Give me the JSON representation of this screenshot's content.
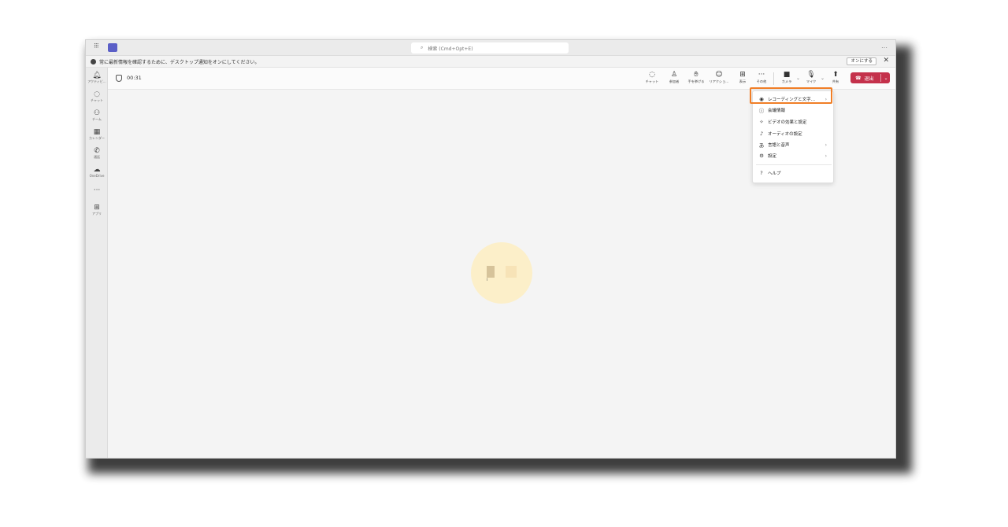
{
  "titlebar": {
    "search_placeholder": "検索 (Cmd+Opt+E)",
    "search_icon": "search-icon",
    "more": "…"
  },
  "notification": {
    "text": "常に最新情報を確認するために、デスクトップ通知をオンにしてください。",
    "button": "オンにする",
    "close": "✕"
  },
  "rail": {
    "items": [
      {
        "icon": "bell-icon",
        "label": "アクティビ…"
      },
      {
        "icon": "chat-icon",
        "label": "チャット"
      },
      {
        "icon": "teams-icon",
        "label": "チーム"
      },
      {
        "icon": "calendar-icon",
        "label": "カレンダー"
      },
      {
        "icon": "phone-icon",
        "label": "通話"
      },
      {
        "icon": "cloud-icon",
        "label": "OneDrive"
      },
      {
        "icon": "more-icon",
        "label": ""
      },
      {
        "icon": "add-app-icon",
        "label": "アプリ"
      }
    ]
  },
  "callbar": {
    "timer": "00:31",
    "buttons": {
      "chat": "チャット",
      "people": "参加者",
      "raise_hand": "手を挙げる",
      "reactions": "リアクショ…",
      "view": "表示",
      "more": "その他",
      "camera": "カメラ",
      "mic": "マイク",
      "share": "共有"
    },
    "leave": "退出"
  },
  "more_menu": {
    "items": [
      {
        "label": "レコーディングと文字…",
        "icon": "record-icon",
        "submenu": true
      },
      {
        "label": "会議情報",
        "icon": "info-icon",
        "submenu": false
      },
      {
        "label": "ビデオの効果と設定",
        "icon": "effects-icon",
        "submenu": false
      },
      {
        "label": "オーディオの設定",
        "icon": "audio-settings-icon",
        "submenu": false
      },
      {
        "label": "言語と音声",
        "icon": "language-icon",
        "submenu": true
      },
      {
        "label": "設定",
        "icon": "gear-icon",
        "submenu": true
      },
      {
        "label": "ヘルプ",
        "icon": "help-icon",
        "submenu": false
      }
    ]
  },
  "colors": {
    "leave_button": "#c4314b",
    "highlight": "#f07e26",
    "avatar_bg": "#fcefc9",
    "teams_purple": "#5b5fc7"
  }
}
